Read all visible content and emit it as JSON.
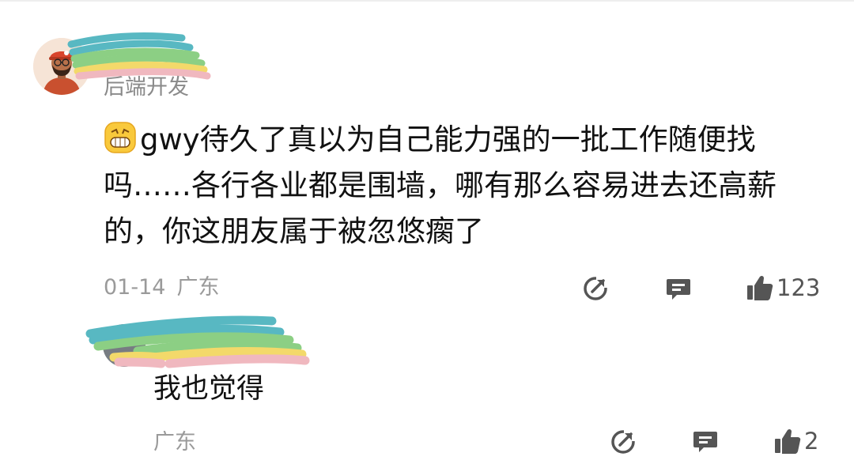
{
  "comment": {
    "author_tag": "后端开发",
    "emoji": "grinning-face",
    "text": "gwy待久了真以为自己能力强的一批工作随便找吗……各行各业都是围墙，哪有那么容易进去还高薪的，你这朋友属于被忽悠瘸了",
    "date": "01-14",
    "location": "广东",
    "like_count": "123",
    "icons": {
      "share": "share-icon",
      "reply": "comment-icon",
      "like": "thumbs-up-icon"
    }
  },
  "reply": {
    "text": "我也觉得",
    "location": "广东",
    "like_count": "2",
    "icons": {
      "share": "share-icon",
      "reply": "comment-icon",
      "like": "thumbs-up-icon"
    }
  },
  "colors": {
    "text_primary": "#111111",
    "text_secondary": "#9a9a9a",
    "icon": "#555555",
    "scribble_teal": "#58b8c2",
    "scribble_green": "#8ccf84",
    "scribble_yellow": "#f3d96a",
    "scribble_pink": "#f0b8bf"
  }
}
